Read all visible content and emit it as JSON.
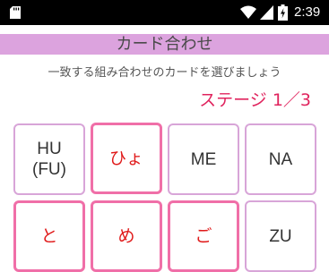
{
  "status_bar": {
    "time": "2:39",
    "icons": [
      "sd-card-icon",
      "wifi-icon",
      "signal-icon",
      "battery-charging-icon"
    ]
  },
  "header": {
    "title": "カード合わせ"
  },
  "instruction": "一致する組み合わせのカードを選びましょう",
  "stage_label": "ステージ 1／3",
  "cards": [
    {
      "label": "HU\n(FU)",
      "script": "romaji"
    },
    {
      "label": "ひょ",
      "script": "kana"
    },
    {
      "label": "ME",
      "script": "romaji"
    },
    {
      "label": "NA",
      "script": "romaji"
    },
    {
      "label": "と",
      "script": "kana"
    },
    {
      "label": "め",
      "script": "kana"
    },
    {
      "label": "ご",
      "script": "kana"
    },
    {
      "label": "ZU",
      "script": "romaji"
    }
  ],
  "colors": {
    "title_bar": "#dca3de",
    "stage_text": "#e0245e",
    "kana_border": "#f06fa8",
    "romaji_border": "#d8a5d8",
    "kana_text": "#e01a1a"
  }
}
